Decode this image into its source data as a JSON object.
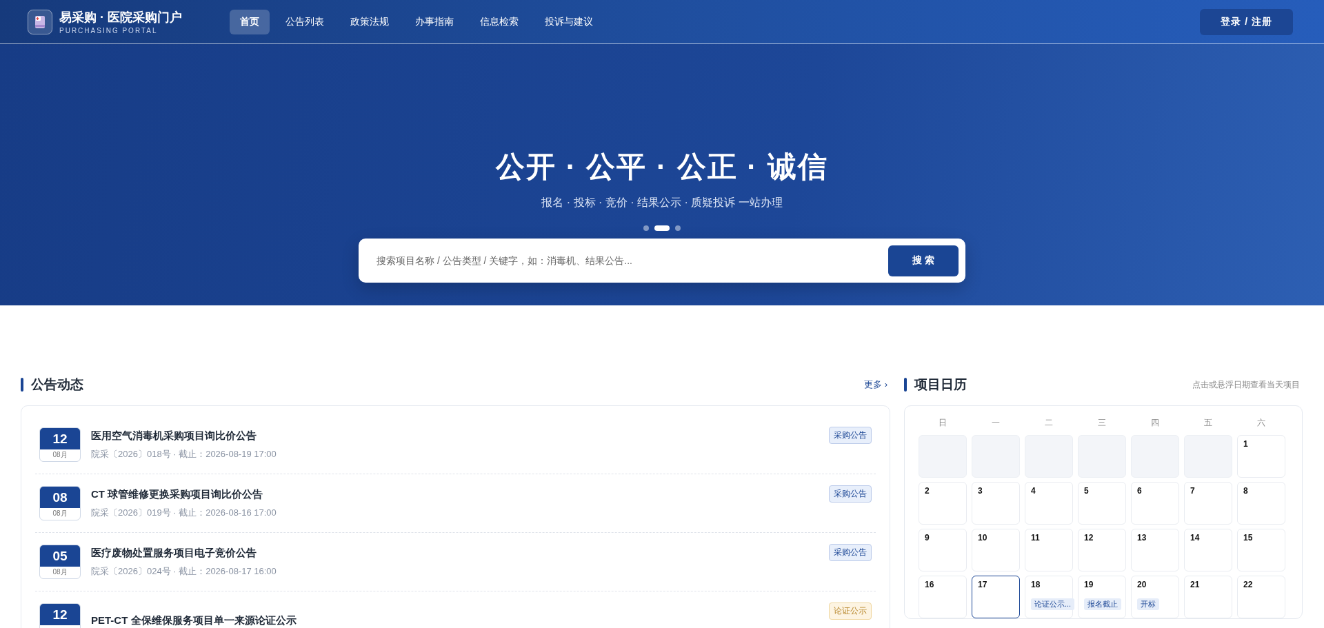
{
  "header": {
    "brand_title": "易采购 · 医院采购门户",
    "brand_subtitle": "PURCHASING PORTAL",
    "nav": [
      {
        "label": "首页",
        "selected": true
      },
      {
        "label": "公告列表",
        "selected": false
      },
      {
        "label": "政策法规",
        "selected": false
      },
      {
        "label": "办事指南",
        "selected": false
      },
      {
        "label": "信息检索",
        "selected": false
      },
      {
        "label": "投诉与建议",
        "selected": false
      }
    ],
    "login_button": "登录 / 注册"
  },
  "hero": {
    "title": "公开 · 公平 · 公正 · 诚信",
    "subtitle": "报名 · 投标 · 竞价 · 结果公示 · 质疑投诉 一站办理",
    "slides": [
      {
        "selected": false
      },
      {
        "selected": true
      },
      {
        "selected": false
      }
    ],
    "search": {
      "placeholder": "搜索项目名称 / 公告类型 / 关键字，如：消毒机、结果公告...",
      "button": "搜 索"
    }
  },
  "announcements": {
    "title": "公告动态",
    "more": "更多 ›",
    "items": [
      {
        "day": "12",
        "month": "08月",
        "title": "医用空气消毒机采购项目询比价公告",
        "meta": "院采〔2026〕018号 · 截止：2026-08-19 17:00",
        "tag": "采购公告",
        "kind": "purchase"
      },
      {
        "day": "08",
        "month": "08月",
        "title": "CT 球管维修更换采购项目询比价公告",
        "meta": "院采〔2026〕019号 · 截止：2026-08-16 17:00",
        "tag": "采购公告",
        "kind": "purchase"
      },
      {
        "day": "05",
        "month": "08月",
        "title": "医疗废物处置服务项目电子竞价公告",
        "meta": "院采〔2026〕024号 · 截止：2026-08-17 16:00",
        "tag": "采购公告",
        "kind": "purchase"
      },
      {
        "day": "12",
        "title": "PET-CT 全保维保服务项目单一来源论证公示",
        "tag": "论证公示",
        "kind": "review"
      }
    ]
  },
  "calendar": {
    "title": "项目日历",
    "hint": "点击或悬浮日期查看当天项目",
    "weekdays": [
      "日",
      "一",
      "二",
      "三",
      "四",
      "五",
      "六"
    ],
    "cells": [
      {
        "kind": "blank"
      },
      {
        "kind": "blank"
      },
      {
        "kind": "blank"
      },
      {
        "kind": "blank"
      },
      {
        "kind": "blank"
      },
      {
        "kind": "blank"
      },
      {
        "kind": "day",
        "day": "1",
        "selected": false
      },
      {
        "kind": "day",
        "day": "2",
        "selected": false
      },
      {
        "kind": "day",
        "day": "3",
        "selected": false
      },
      {
        "kind": "day",
        "day": "4",
        "selected": false
      },
      {
        "kind": "day",
        "day": "5",
        "selected": false
      },
      {
        "kind": "day",
        "day": "6",
        "selected": false
      },
      {
        "kind": "day",
        "day": "7",
        "selected": false
      },
      {
        "kind": "day",
        "day": "8",
        "selected": false
      },
      {
        "kind": "day",
        "day": "9",
        "selected": false
      },
      {
        "kind": "day",
        "day": "10",
        "selected": false
      },
      {
        "kind": "day",
        "day": "11",
        "selected": false
      },
      {
        "kind": "day",
        "day": "12",
        "selected": false
      },
      {
        "kind": "day",
        "day": "13",
        "selected": false
      },
      {
        "kind": "day",
        "day": "14",
        "selected": false
      },
      {
        "kind": "day",
        "day": "15",
        "selected": false
      },
      {
        "kind": "day",
        "day": "16",
        "selected": false
      },
      {
        "kind": "day",
        "day": "17",
        "selected": true
      },
      {
        "kind": "day",
        "day": "18",
        "selected": false,
        "event": "论证公示..."
      },
      {
        "kind": "day",
        "day": "19",
        "selected": false,
        "event": "报名截止"
      },
      {
        "kind": "day",
        "day": "20",
        "selected": false,
        "event": "开标"
      },
      {
        "kind": "day",
        "day": "21",
        "selected": false
      },
      {
        "kind": "day",
        "day": "22",
        "selected": false
      }
    ]
  }
}
